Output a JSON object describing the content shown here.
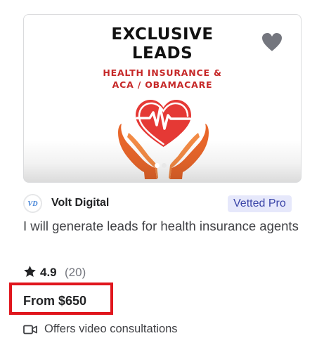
{
  "thumbnail": {
    "title_line1": "EXCLUSIVE",
    "title_line2": "LEADS",
    "subtitle_line1": "HEALTH INSURANCE &",
    "subtitle_line2": "ACA / OBAMACARE",
    "slide_count": 2,
    "active_slide": 1,
    "colors": {
      "title": "#111111",
      "subtitle": "#c62828",
      "heart": "#e53935",
      "hands": "#e8662a"
    }
  },
  "favorite": {
    "icon": "heart-icon"
  },
  "seller": {
    "name": "Volt Digital",
    "avatar_text": "VD",
    "badge": "Vetted Pro",
    "badge_color": "#3b45a8"
  },
  "gig": {
    "title": "I will generate leads for health insurance agents"
  },
  "rating": {
    "icon": "star-icon",
    "value": "4.9",
    "count": "(20)"
  },
  "price": {
    "label": "From $650",
    "highlight_color": "#e0161d"
  },
  "video": {
    "icon": "video-camera-icon",
    "label": "Offers video consultations"
  }
}
